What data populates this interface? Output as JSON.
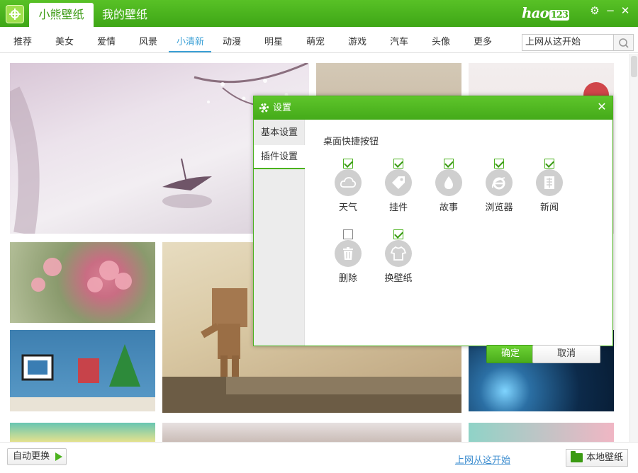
{
  "app": {
    "tab_main": "小熊壁纸",
    "tab_mine": "我的壁纸",
    "brand_text": "hao",
    "brand_num": "123",
    "accent_color": "#4bb21e",
    "link_color": "#3e8ed0"
  },
  "window_buttons": [
    {
      "icon": "gear-icon",
      "glyph": "⚙"
    },
    {
      "icon": "minimize-icon",
      "glyph": "−"
    },
    {
      "icon": "close-icon",
      "glyph": "✕"
    }
  ],
  "nav": {
    "items": [
      {
        "label": "推荐"
      },
      {
        "label": "美女"
      },
      {
        "label": "爱情"
      },
      {
        "label": "风景"
      },
      {
        "label": "小清新",
        "active": true
      },
      {
        "label": "动漫"
      },
      {
        "label": "明星"
      },
      {
        "label": "萌宠"
      },
      {
        "label": "游戏"
      },
      {
        "label": "汽车"
      },
      {
        "label": "头像"
      },
      {
        "label": "更多"
      }
    ],
    "search_value": "上网从这开始"
  },
  "bottom": {
    "auto_change": "自动更换",
    "link": "上网从这开始",
    "local": "本地壁纸"
  },
  "dialog": {
    "title": "设置",
    "tabs": [
      "基本设置",
      "插件设置"
    ],
    "active_tab": 1,
    "section_title": "桌面快捷按钮",
    "plugins": [
      {
        "label": "天气",
        "checked": true,
        "icon": "cloud-icon"
      },
      {
        "label": "挂件",
        "checked": true,
        "icon": "tag-icon"
      },
      {
        "label": "故事",
        "checked": true,
        "icon": "drop-icon"
      },
      {
        "label": "浏览器",
        "checked": true,
        "icon": "ie-icon"
      },
      {
        "label": "新闻",
        "checked": true,
        "icon": "news-icon"
      },
      {
        "label": "删除",
        "checked": false,
        "icon": "trash-icon"
      },
      {
        "label": "换壁纸",
        "checked": true,
        "icon": "shirt-icon"
      }
    ],
    "ok": "确定",
    "cancel": "取消"
  }
}
